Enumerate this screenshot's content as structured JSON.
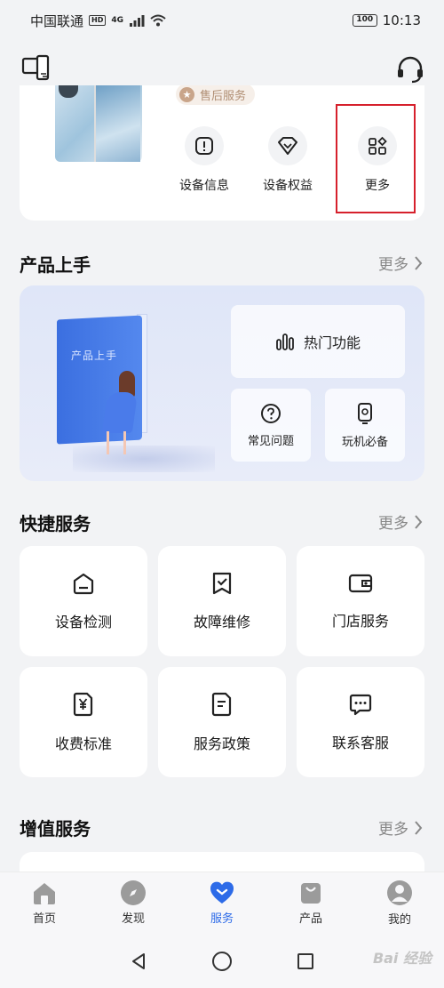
{
  "status_bar": {
    "carrier": "中国联通",
    "hd_badge": "HD",
    "network": "4G",
    "battery": "100",
    "time": "10:13"
  },
  "device_card": {
    "after_sales_tag": "售后服务",
    "quick_items": [
      {
        "label": "设备信息",
        "icon": "info-icon"
      },
      {
        "label": "设备权益",
        "icon": "diamond-icon"
      },
      {
        "label": "更多",
        "icon": "apps-icon"
      }
    ]
  },
  "guide_section": {
    "title": "产品上手",
    "more": "更多",
    "book_title": "产品上手",
    "tiles": [
      {
        "label": "热门功能",
        "icon": "bar-chart-icon"
      },
      {
        "label": "常见问题",
        "icon": "question-icon"
      },
      {
        "label": "玩机必备",
        "icon": "phone-tip-icon"
      }
    ]
  },
  "quick_services": {
    "title": "快捷服务",
    "more": "更多",
    "items": [
      {
        "label": "设备检测",
        "icon": "device-check-icon"
      },
      {
        "label": "故障维修",
        "icon": "repair-icon"
      },
      {
        "label": "门店服务",
        "icon": "store-icon"
      },
      {
        "label": "收费标准",
        "icon": "yuan-icon"
      },
      {
        "label": "服务政策",
        "icon": "policy-icon"
      },
      {
        "label": "联系客服",
        "icon": "chat-icon"
      }
    ]
  },
  "value_added": {
    "title": "增值服务",
    "more": "更多"
  },
  "tabbar": {
    "active_color": "#2d6be8",
    "items": [
      {
        "label": "首页",
        "icon": "home-icon"
      },
      {
        "label": "发现",
        "icon": "compass-icon"
      },
      {
        "label": "服务",
        "icon": "heart-icon"
      },
      {
        "label": "产品",
        "icon": "bag-icon"
      },
      {
        "label": "我的",
        "icon": "user-icon"
      }
    ]
  },
  "watermark": "Bai 经验"
}
